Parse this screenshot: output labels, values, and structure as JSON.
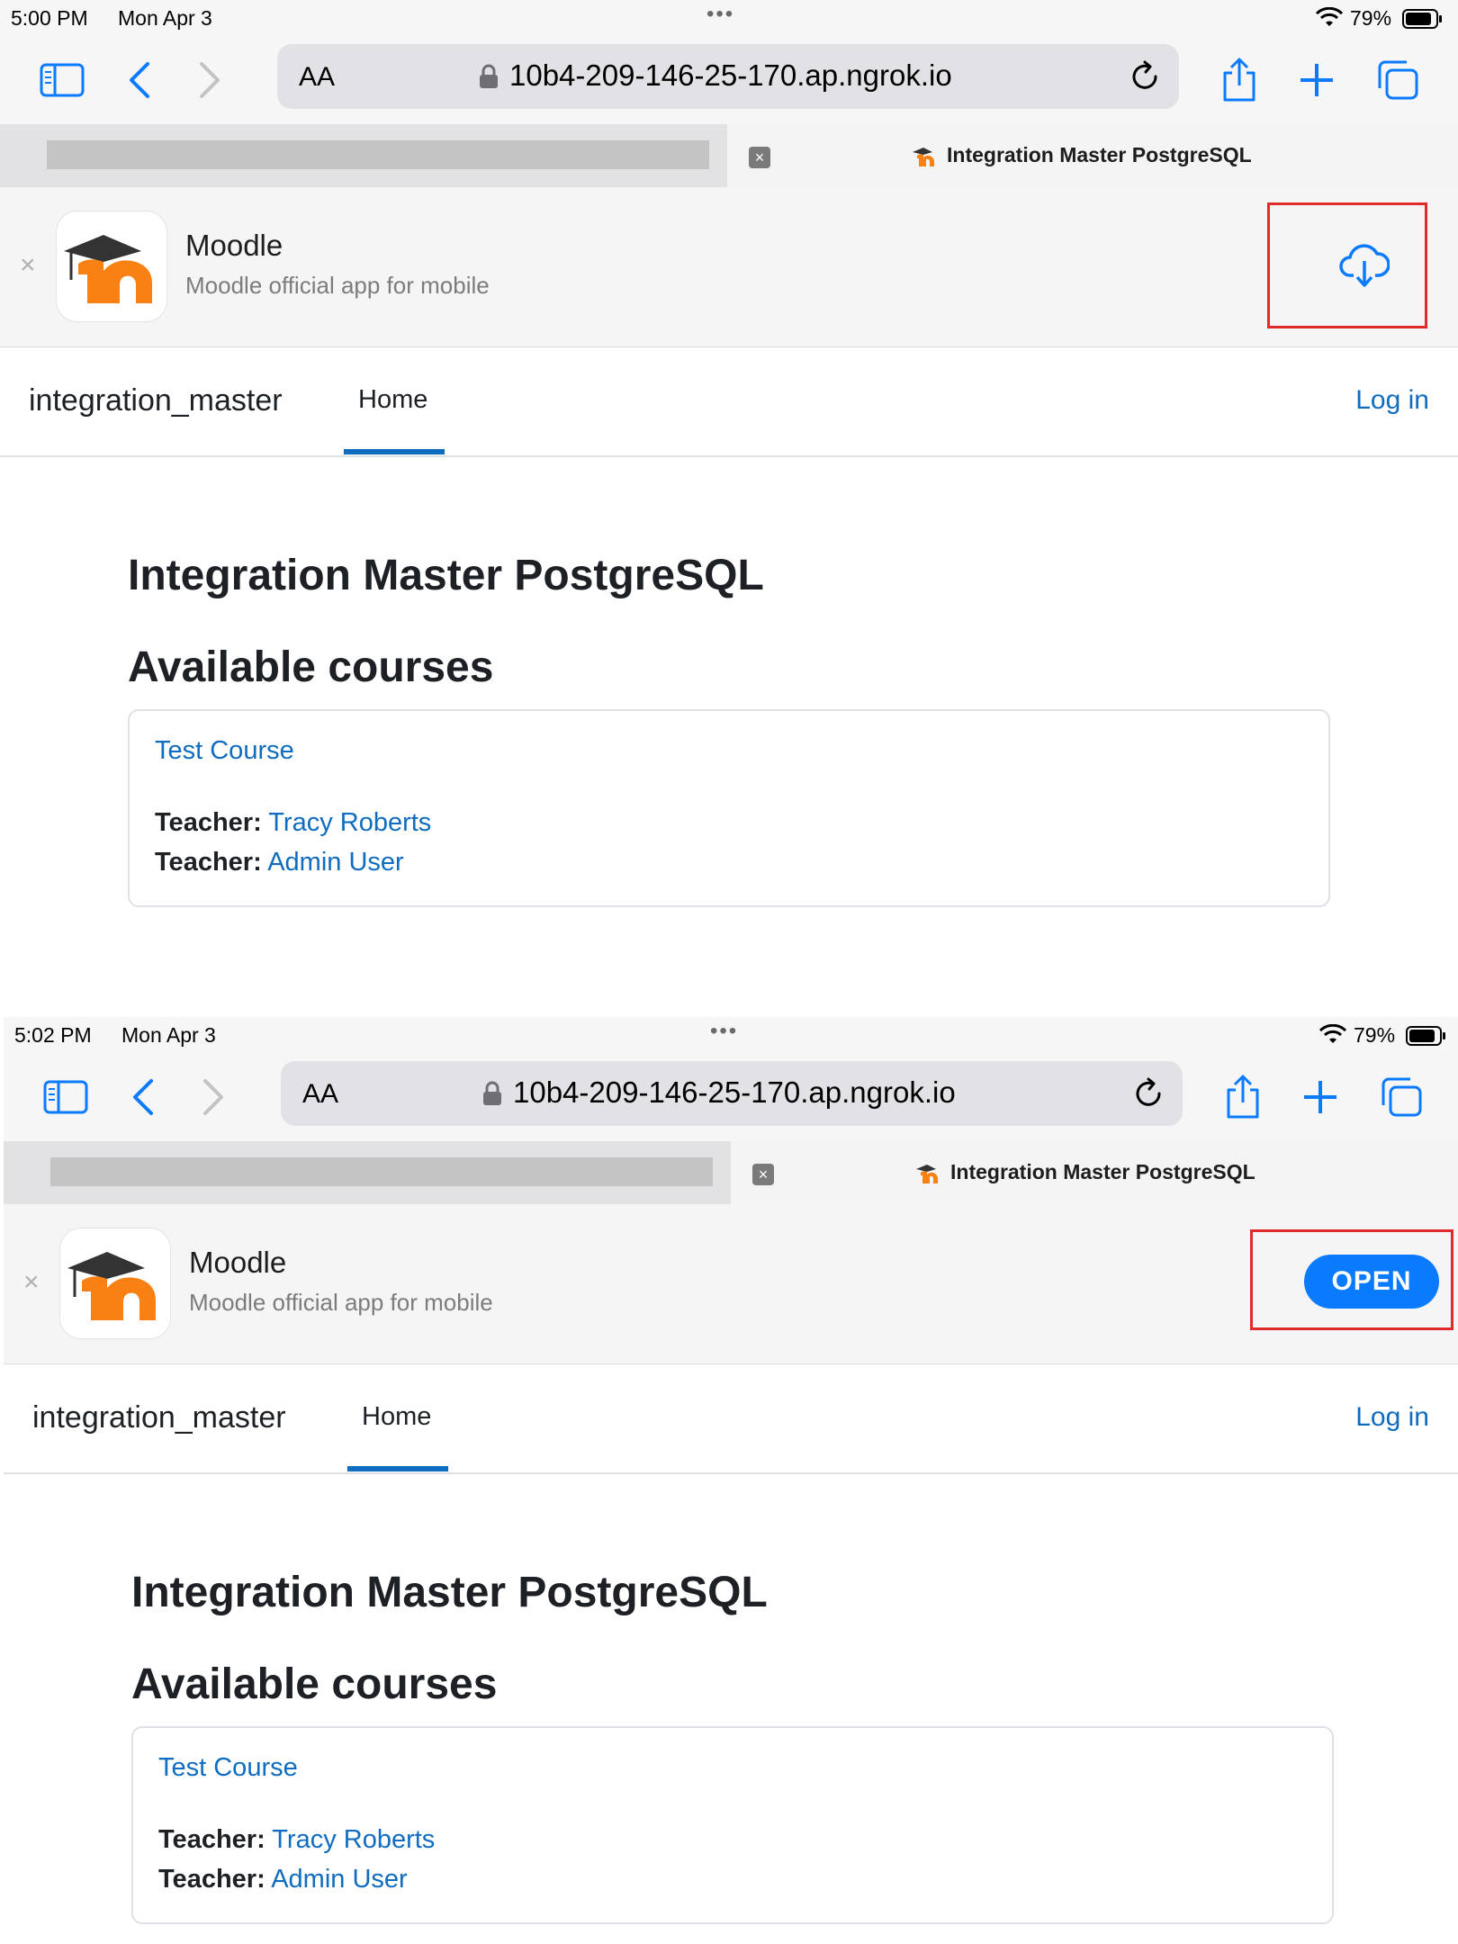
{
  "screenshots": [
    {
      "status": {
        "time": "5:00 PM",
        "date": "Mon Apr 3",
        "battery": "79%"
      },
      "banner_action": "download"
    },
    {
      "status": {
        "time": "5:02 PM",
        "date": "Mon Apr 3",
        "battery": "79%"
      },
      "banner_action": "open"
    }
  ],
  "browser": {
    "address_aa": "AA",
    "url": "10b4-209-146-25-170.ap.ngrok.io",
    "active_tab_title": "Integration Master PostgreSQL",
    "close_tab_glyph": "×"
  },
  "banner": {
    "app_name": "Moodle",
    "app_subtitle": "Moodle official app for mobile",
    "open_label": "OPEN",
    "close_glyph": "×",
    "download_icon": "cloud-download-icon"
  },
  "nav": {
    "brand": "integration_master",
    "home": "Home",
    "login": "Log in"
  },
  "content": {
    "site_title": "Integration Master PostgreSQL",
    "courses_heading": "Available courses",
    "course": {
      "name": "Test Course",
      "teachers": [
        {
          "label": "Teacher:",
          "name": "Tracy Roberts"
        },
        {
          "label": "Teacher:",
          "name": "Admin User"
        }
      ]
    }
  },
  "colors": {
    "link": "#0f6cbf",
    "ios_blue": "#0a7aff",
    "highlight": "#e12a2a",
    "moodle_orange": "#f98012"
  }
}
